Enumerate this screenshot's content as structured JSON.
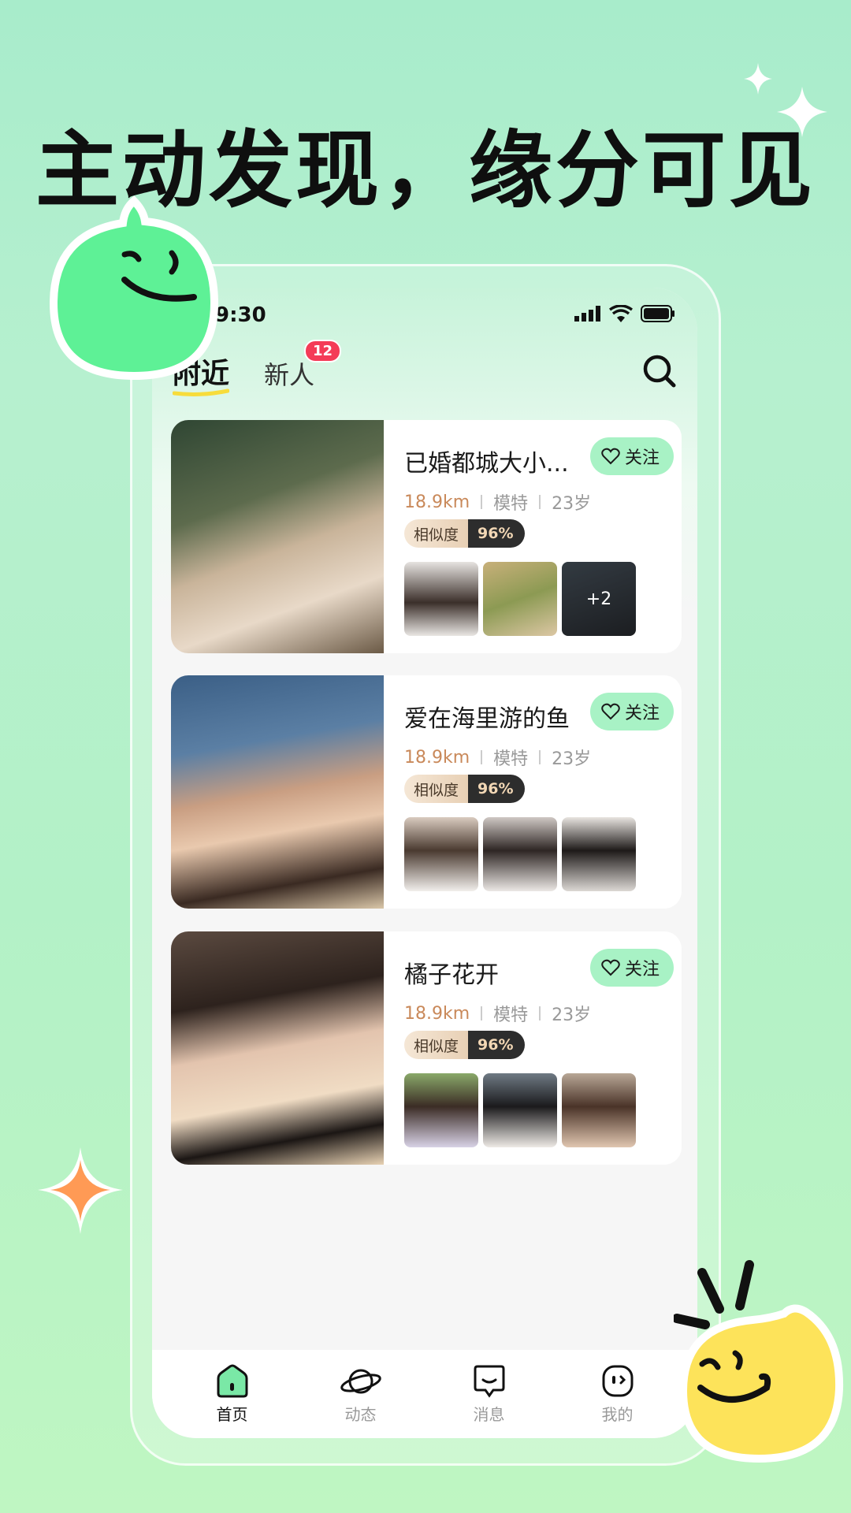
{
  "headline": "主动发现，缘分可见",
  "status": {
    "time": "9:30"
  },
  "tabs": [
    {
      "label": "附近",
      "active": true
    },
    {
      "label": "新人",
      "badge": "12",
      "active": false
    }
  ],
  "users": [
    {
      "name": "已婚都城大小...",
      "distance": "18.9km",
      "job": "模特",
      "age": "23岁",
      "similarity_label": "相似度",
      "similarity": "96%",
      "follow": "关注",
      "more_photos": "+2"
    },
    {
      "name": "爱在海里游的鱼",
      "distance": "18.9km",
      "job": "模特",
      "age": "23岁",
      "similarity_label": "相似度",
      "similarity": "96%",
      "follow": "关注"
    },
    {
      "name": "橘子花开",
      "distance": "18.9km",
      "job": "模特",
      "age": "23岁",
      "similarity_label": "相似度",
      "similarity": "96%",
      "follow": "关注"
    }
  ],
  "nav": [
    {
      "label": "首页",
      "icon": "home-icon",
      "active": true
    },
    {
      "label": "动态",
      "icon": "planet-icon",
      "active": false
    },
    {
      "label": "消息",
      "icon": "message-icon",
      "active": false
    },
    {
      "label": "我的",
      "icon": "profile-icon",
      "active": false
    }
  ],
  "colors": {
    "accent": "#a8f2c5",
    "badge": "#f43b57",
    "distance": "#c9895a"
  }
}
